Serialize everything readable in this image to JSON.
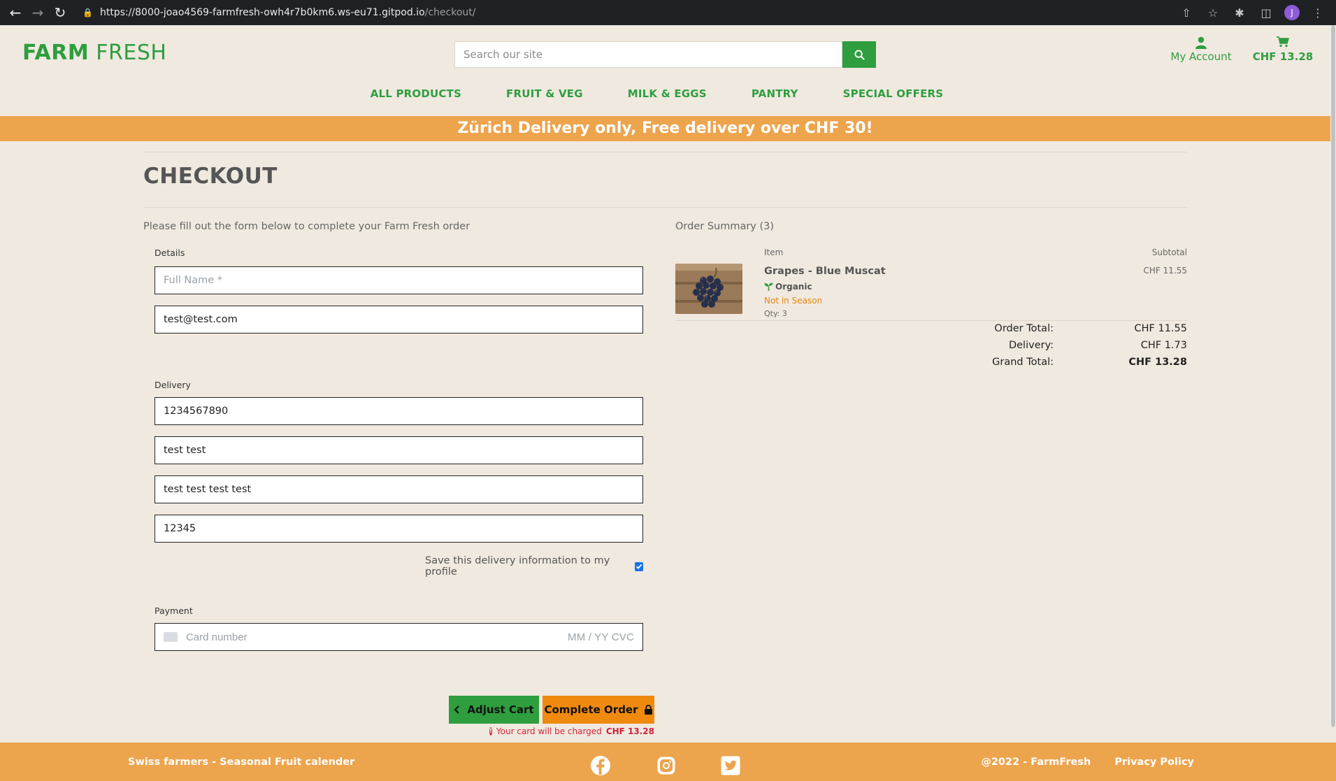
{
  "browser": {
    "url_host": "https://8000-joao4569-farmfresh-owh4r7b0km6.ws-eu71.gitpod.io",
    "url_path": "/checkout/",
    "profile_initial": "J"
  },
  "header": {
    "logo_bold": "FARM",
    "logo_light": "FRESH",
    "search_placeholder": "Search our site",
    "account_label": "My Account",
    "cart_total": "CHF 13.28"
  },
  "nav": {
    "items": [
      "ALL PRODUCTS",
      "FRUIT & VEG",
      "MILK & EGGS",
      "PANTRY",
      "SPECIAL OFFERS"
    ]
  },
  "banner": {
    "text": "Zürich Delivery only, Free delivery over CHF 30!"
  },
  "checkout": {
    "title": "CHECKOUT",
    "intro": "Please fill out the form below to complete your Farm Fresh order",
    "details_label": "Details",
    "full_name_placeholder": "Full Name *",
    "email_value": "test@test.com",
    "delivery_label": "Delivery",
    "phone_value": "1234567890",
    "address1_value": "test test",
    "address2_value": "test test test test",
    "postcode_value": "12345",
    "save_info_label": "Save this delivery information to my profile",
    "payment_label": "Payment",
    "card_placeholder": "Card number",
    "card_exp_cvc": "MM / YY  CVC",
    "adjust_cart_label": "Adjust Cart",
    "complete_order_label": "Complete Order",
    "charge_note_prefix": "Your card will be charged",
    "charge_amount": "CHF 13.28"
  },
  "summary": {
    "title": "Order Summary (3)",
    "col_item": "Item",
    "col_subtotal": "Subtotal",
    "product_name": "Grapes - Blue Muscat",
    "organic_label": "Organic",
    "season_label": "Not in Season",
    "qty_label": "Qty: 3",
    "line_subtotal": "CHF 11.55",
    "order_total_label": "Order Total:",
    "order_total_value": "CHF 11.55",
    "delivery_label": "Delivery:",
    "delivery_value": "CHF 1.73",
    "grand_total_label": "Grand Total:",
    "grand_total_value": "CHF 13.28"
  },
  "footer": {
    "left_text": "Swiss farmers - Seasonal Fruit calender",
    "copyright": "@2022 - FarmFresh",
    "privacy": "Privacy Policy"
  },
  "colors": {
    "brand_green": "#2e9e3e",
    "banner_orange": "#eca44d",
    "button_orange": "#f08a0e",
    "page_bg": "#f0e9e0",
    "error_red": "#d3223a"
  }
}
